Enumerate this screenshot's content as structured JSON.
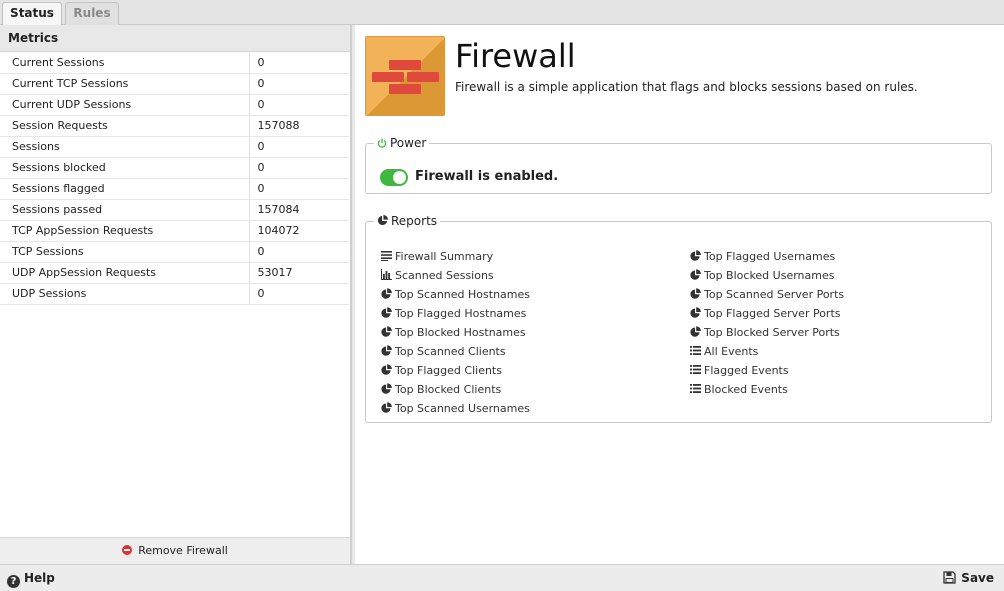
{
  "tabs": [
    {
      "label": "Status",
      "active": true
    },
    {
      "label": "Rules",
      "active": false
    }
  ],
  "metrics": {
    "header": "Metrics",
    "rows": [
      {
        "name": "Current Sessions",
        "value": "0"
      },
      {
        "name": "Current TCP Sessions",
        "value": "0"
      },
      {
        "name": "Current UDP Sessions",
        "value": "0"
      },
      {
        "name": "Session Requests",
        "value": "157088"
      },
      {
        "name": "Sessions",
        "value": "0"
      },
      {
        "name": "Sessions blocked",
        "value": "0"
      },
      {
        "name": "Sessions flagged",
        "value": "0"
      },
      {
        "name": "Sessions passed",
        "value": "157084"
      },
      {
        "name": "TCP AppSession Requests",
        "value": "104072"
      },
      {
        "name": "TCP Sessions",
        "value": "0"
      },
      {
        "name": "UDP AppSession Requests",
        "value": "53017"
      },
      {
        "name": "UDP Sessions",
        "value": "0"
      }
    ],
    "remove_label": "Remove Firewall"
  },
  "app": {
    "title": "Firewall",
    "description": "Firewall is a simple application that flags and blocks sessions based on rules.",
    "icon": "firewall-bricks-icon"
  },
  "power": {
    "legend": "Power",
    "status_text": "Firewall is enabled.",
    "enabled": true,
    "toggle_color": "#3fb83f"
  },
  "reports": {
    "legend": "Reports",
    "column_left": [
      {
        "label": "Firewall Summary",
        "icon": "list-icon"
      },
      {
        "label": "Scanned Sessions",
        "icon": "bar-chart-icon"
      },
      {
        "label": "Top Scanned Hostnames",
        "icon": "pie-chart-icon"
      },
      {
        "label": "Top Flagged Hostnames",
        "icon": "pie-chart-icon"
      },
      {
        "label": "Top Blocked Hostnames",
        "icon": "pie-chart-icon"
      },
      {
        "label": "Top Scanned Clients",
        "icon": "pie-chart-icon"
      },
      {
        "label": "Top Flagged Clients",
        "icon": "pie-chart-icon"
      },
      {
        "label": "Top Blocked Clients",
        "icon": "pie-chart-icon"
      },
      {
        "label": "Top Scanned Usernames",
        "icon": "pie-chart-icon"
      }
    ],
    "column_right": [
      {
        "label": "Top Flagged Usernames",
        "icon": "pie-chart-icon"
      },
      {
        "label": "Top Blocked Usernames",
        "icon": "pie-chart-icon"
      },
      {
        "label": "Top Scanned Server Ports",
        "icon": "pie-chart-icon"
      },
      {
        "label": "Top Flagged Server Ports",
        "icon": "pie-chart-icon"
      },
      {
        "label": "Top Blocked Server Ports",
        "icon": "pie-chart-icon"
      },
      {
        "label": "All Events",
        "icon": "event-list-icon"
      },
      {
        "label": "Flagged Events",
        "icon": "event-list-icon"
      },
      {
        "label": "Blocked Events",
        "icon": "event-list-icon"
      }
    ]
  },
  "footer": {
    "help_label": "Help",
    "save_label": "Save"
  }
}
